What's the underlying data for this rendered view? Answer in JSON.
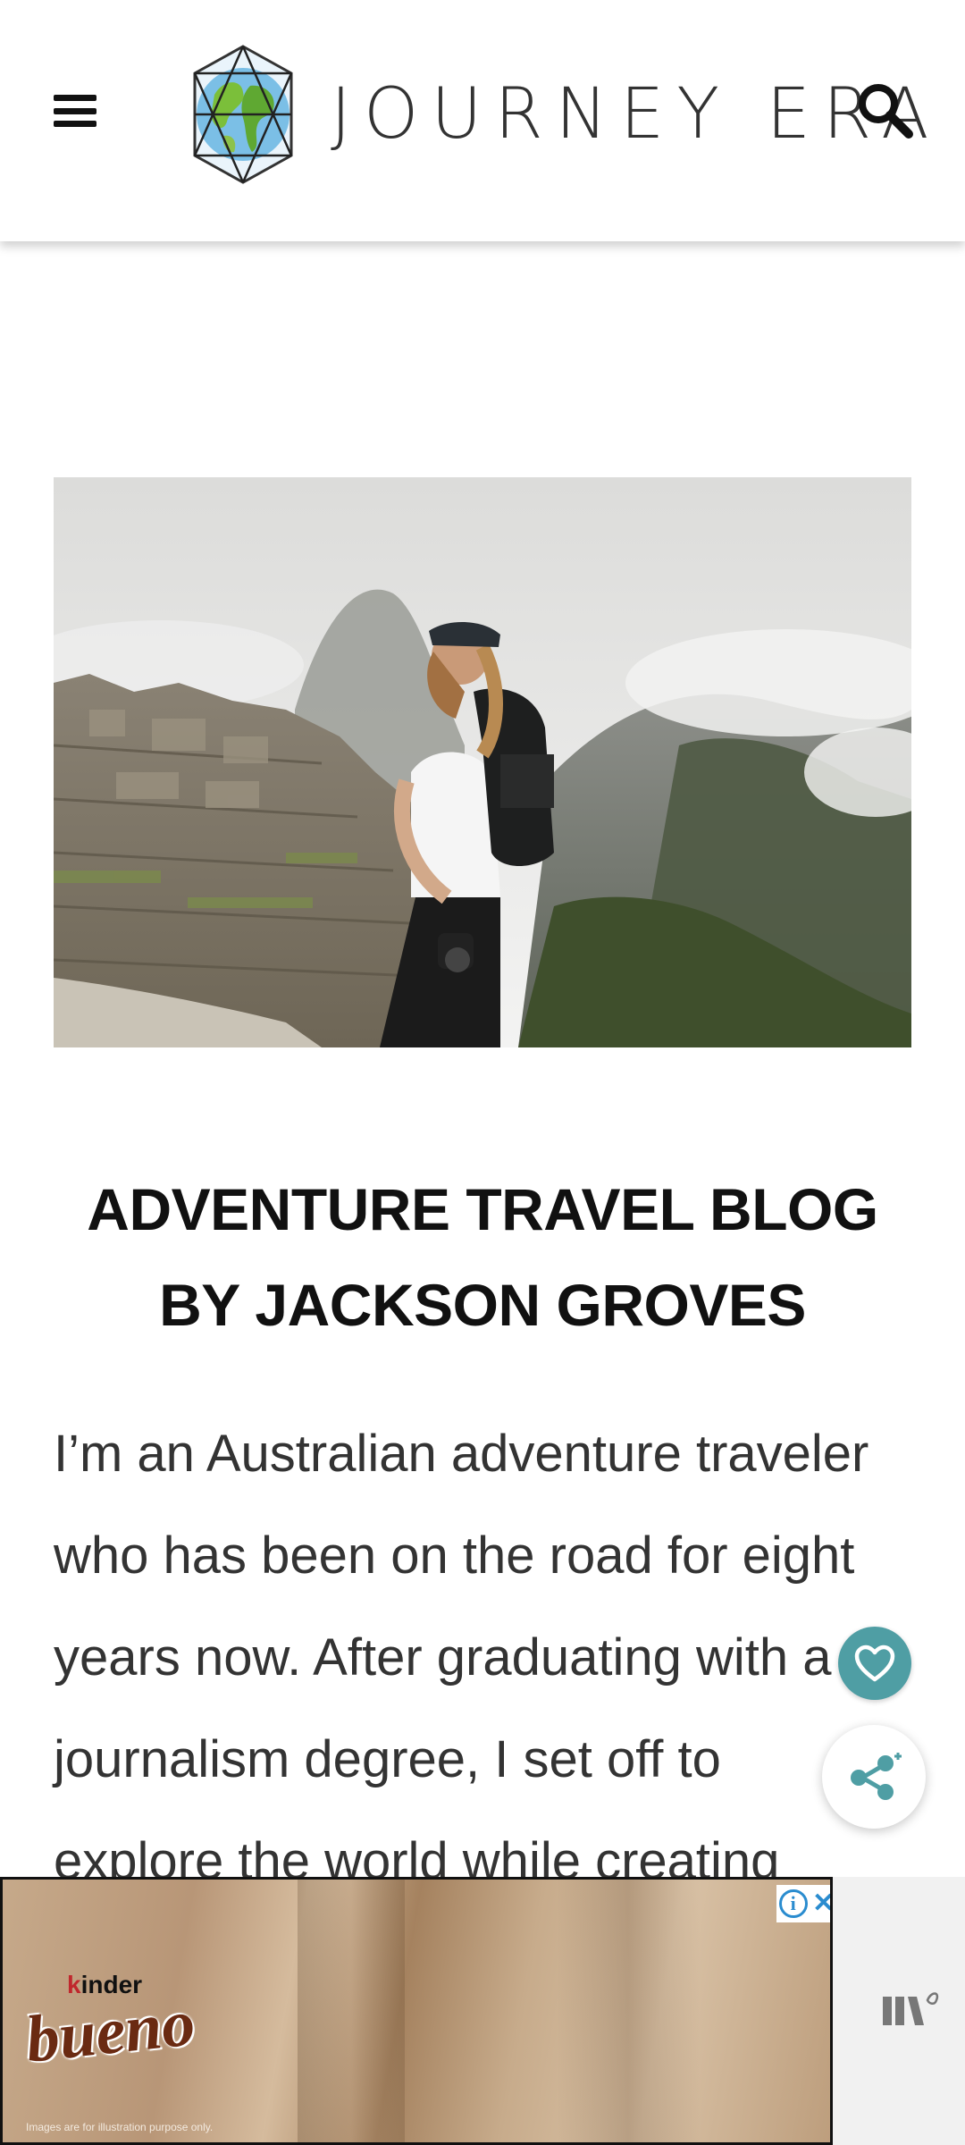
{
  "header": {
    "menu_icon": "hamburger-menu-icon",
    "logo_text": "JOURNEY ERA",
    "search_icon": "search-icon"
  },
  "hero": {
    "image_icon": "hero-photo"
  },
  "main": {
    "title_line1": "ADVENTURE TRAVEL BLOG",
    "title_line2": "BY JACKSON GROVES",
    "intro_lines": [
      "I’m an Australian adventure traveler",
      "who has been on the road for eight",
      "years now. After graduating with a",
      "journalism degree, I set off to",
      "explore the world while creating"
    ]
  },
  "floating": {
    "heart_icon": "heart-icon",
    "share_icon": "share-icon",
    "heart_color": "#4f9ea4"
  },
  "ad": {
    "brand_small_k": "k",
    "brand_small_rest": "inder",
    "brand": "bueno",
    "disclaimer": "Images are for illustration purpose only.",
    "info_label": "i",
    "close_label": "✕",
    "network_icon": "ad-network-logo-icon"
  }
}
